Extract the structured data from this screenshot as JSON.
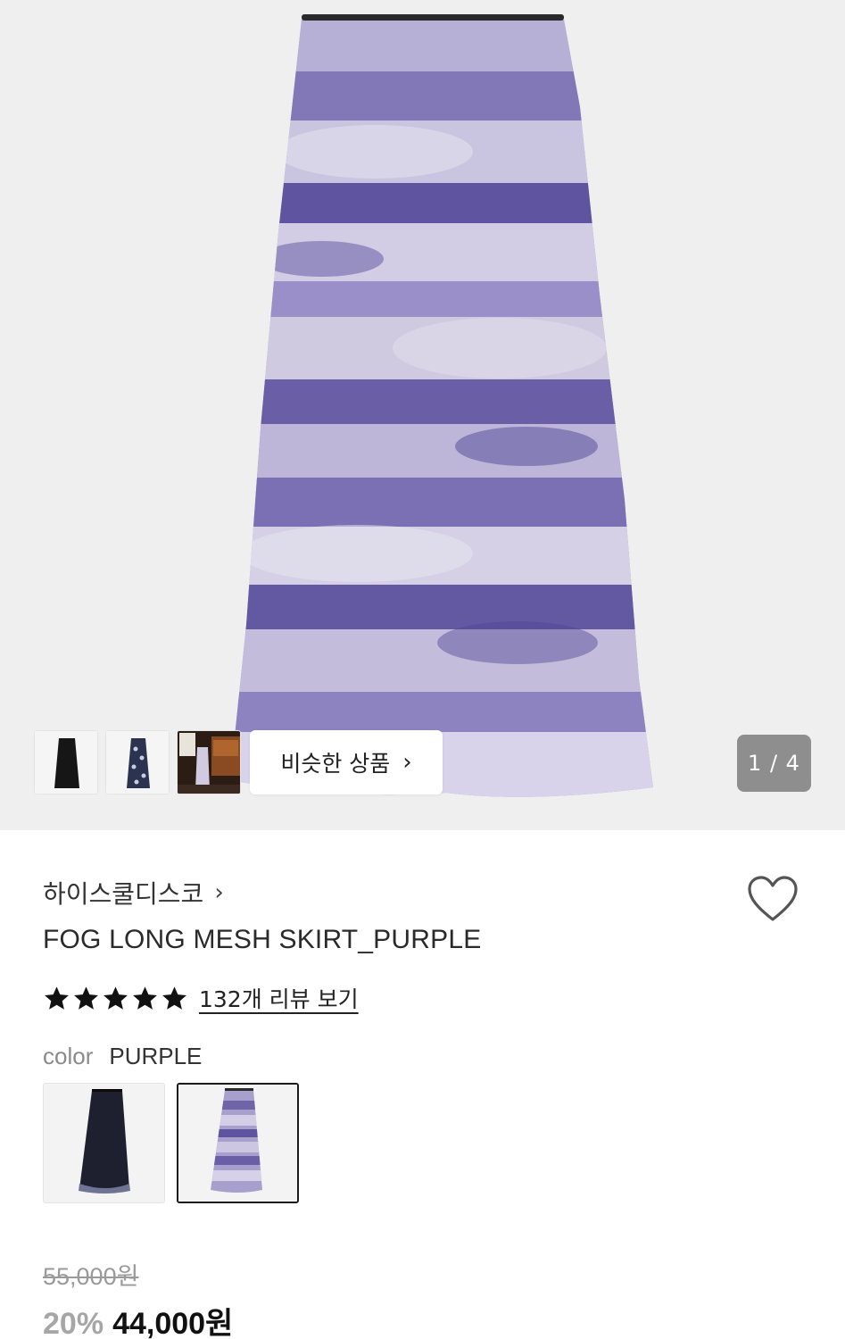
{
  "gallery": {
    "counter": "1 / 4",
    "similar_label": "비슷한 상품",
    "similar_chevron": "›",
    "thumbnails": [
      "black-skirt-thumbnail",
      "floral-skirt-thumbnail",
      "styled-photo-thumbnail"
    ]
  },
  "product": {
    "brand": "하이스쿨디스코",
    "brand_chevron": "›",
    "name": "FOG LONG MESH SKIRT_PURPLE",
    "rating_stars": 5,
    "review_link": "132개 리뷰 보기"
  },
  "color": {
    "label": "color",
    "selected": "PURPLE",
    "options": [
      "black-skirt-swatch",
      "purple-skirt-swatch"
    ]
  },
  "price": {
    "original": "55,000원",
    "discount": "20%",
    "sale": "44,000원"
  },
  "colors": {
    "skirt_purple": "#7a6fb0",
    "skirt_light": "#c9c3de",
    "hero_bg": "#efefef",
    "counter_bg": "#8e8e8e"
  }
}
